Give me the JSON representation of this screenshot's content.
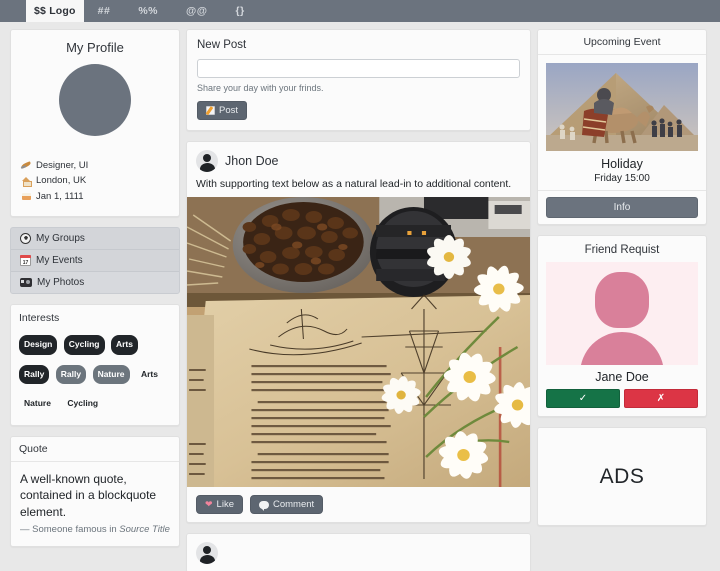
{
  "navbar": {
    "brand": "$$ Logo",
    "links": [
      "##",
      "%%",
      "@@",
      "{}"
    ]
  },
  "profile": {
    "title": "My Profile",
    "avatar_color": "#6b737e",
    "meta": [
      {
        "icon": "quill-icon",
        "text": "Designer, UI"
      },
      {
        "icon": "house-icon",
        "text": "London, UK"
      },
      {
        "icon": "cake-icon",
        "text": "Jan 1, 1111"
      }
    ]
  },
  "nav_list": [
    {
      "icon": "globe-icon",
      "label": "My Groups"
    },
    {
      "icon": "calendar-icon",
      "label": "My Events",
      "day": "17"
    },
    {
      "icon": "camera-icon",
      "label": "My Photos"
    }
  ],
  "interests": {
    "title": "Interests",
    "tags": [
      {
        "label": "Design",
        "style": "dark"
      },
      {
        "label": "Cycling",
        "style": "dark"
      },
      {
        "label": "Arts",
        "style": "dark"
      },
      {
        "label": "Rally",
        "style": "dark"
      },
      {
        "label": "Rally",
        "style": "sec"
      },
      {
        "label": "Nature",
        "style": "sec"
      },
      {
        "label": "Arts",
        "style": "none"
      },
      {
        "label": "Nature",
        "style": "none"
      },
      {
        "label": "Cycling",
        "style": "none"
      }
    ]
  },
  "quote": {
    "title": "Quote",
    "text": "A well-known quote, contained in a blockquote element.",
    "attribution": "— Someone famous in",
    "source": "Source Title"
  },
  "new_post": {
    "title": "New Post",
    "input_value": "",
    "input_placeholder": "",
    "help_text": "Share your day with your frinds.",
    "button_label": "Post",
    "button_icon": "memo-icon"
  },
  "post": {
    "author": "Jhon Doe",
    "avatar_icon": "user-avatar-icon",
    "text": "With supporting text below as a natural lead-in to additional content.",
    "image_alt": "coffee beans, camera lens, open book and white daisies",
    "like_label": "Like",
    "like_icon": "heart-icon",
    "comment_label": "Comment",
    "comment_icon": "speech-balloon-icon"
  },
  "event": {
    "title": "Upcoming Event",
    "image_alt": "pyramid with camel and tourists",
    "name": "Holiday",
    "time": "Friday 15:00",
    "button_label": "Info"
  },
  "friend_request": {
    "title": "Friend Requist",
    "name": "Jane Doe",
    "accept_icon": "check-icon",
    "decline_icon": "cross-icon",
    "accept_color": "#157347",
    "decline_color": "#dc3545",
    "placeholder_color": "#d9809a"
  },
  "ads": {
    "label": "ADS"
  },
  "colors": {
    "navbar": "#6b737e",
    "page_background": "#e8e8e8",
    "card_background": "#fbfbfb",
    "accent_button": "#5d6671"
  }
}
